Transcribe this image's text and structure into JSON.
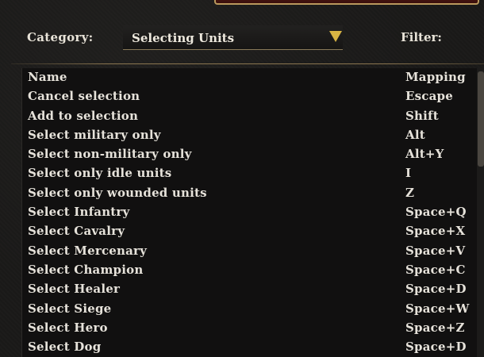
{
  "header": {
    "category_label": "Category:",
    "category_selected": "Selecting Units",
    "filter_label": "Filter:"
  },
  "table": {
    "columns": [
      "Name",
      "Mapping"
    ],
    "rows": [
      {
        "name": "Cancel selection",
        "mapping": "Escape"
      },
      {
        "name": "Add to selection",
        "mapping": "Shift"
      },
      {
        "name": "Select military only",
        "mapping": "Alt"
      },
      {
        "name": "Select non-military only",
        "mapping": "Alt+Y"
      },
      {
        "name": "Select only idle units",
        "mapping": "I"
      },
      {
        "name": "Select only wounded units",
        "mapping": "Z"
      },
      {
        "name": "Select Infantry",
        "mapping": "Space+Q"
      },
      {
        "name": "Select Cavalry",
        "mapping": "Space+X"
      },
      {
        "name": "Select Mercenary",
        "mapping": "Space+V"
      },
      {
        "name": "Select Champion",
        "mapping": "Space+C"
      },
      {
        "name": "Select Healer",
        "mapping": "Space+D"
      },
      {
        "name": "Select Siege",
        "mapping": "Space+W"
      },
      {
        "name": "Select Hero",
        "mapping": "Space+Z"
      },
      {
        "name": "Select Dog",
        "mapping": "Space+D"
      }
    ]
  },
  "colors": {
    "accent_gold": "#d8b443",
    "text": "#e6e2da",
    "header_red": "#5a1c17"
  }
}
